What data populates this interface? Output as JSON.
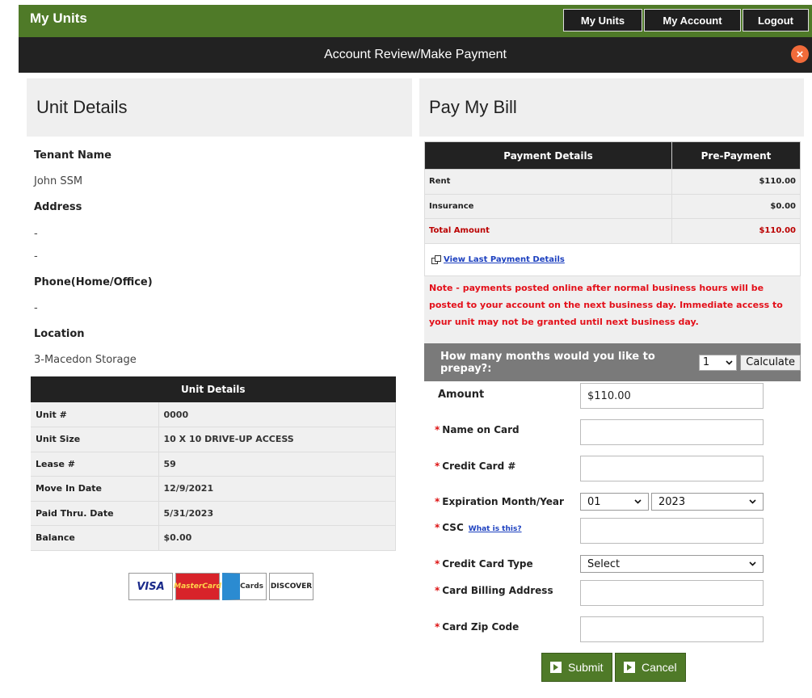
{
  "header": {
    "title": "My Units",
    "nav": [
      "My Units",
      "My Account",
      "Logout"
    ]
  },
  "modal": {
    "title": "Account Review/Make Payment",
    "close_glyph": "×"
  },
  "unit_details": {
    "section_title": "Unit Details",
    "tenant_name_label": "Tenant Name",
    "tenant_name": "John SSM",
    "address_label": "Address",
    "address_line1": "-",
    "address_line2": "-",
    "phone_label": "Phone(Home/Office)",
    "phone": "-",
    "location_label": "Location",
    "location": "3-Macedon Storage",
    "table_header": "Unit Details",
    "rows": [
      {
        "label": "Unit #",
        "value": "0000"
      },
      {
        "label": "Unit Size",
        "value": "10 X 10 DRIVE-UP ACCESS"
      },
      {
        "label": "Lease #",
        "value": "59"
      },
      {
        "label": "Move In Date",
        "value": "12/9/2021"
      },
      {
        "label": "Paid Thru. Date",
        "value": "5/31/2023"
      },
      {
        "label": "Balance",
        "value": "$0.00"
      }
    ],
    "cards": [
      "VISA",
      "MasterCard",
      "Cards",
      "DISCOVER"
    ]
  },
  "pay_bill": {
    "section_title": "Pay My Bill",
    "col_details": "Payment Details",
    "col_prepay": "Pre-Payment",
    "rows": [
      {
        "label": "Rent",
        "value": "$110.00"
      },
      {
        "label": "Insurance",
        "value": "$0.00"
      },
      {
        "label": "Total Amount",
        "value": "$110.00"
      }
    ],
    "view_last": "View Last Payment Details",
    "note": "Note - payments posted online after normal business hours will be posted to your account on the next business day. Immediate access to your unit may not be granted until next business day.",
    "prepay_question": "How many months would you like to prepay?:",
    "prepay_months": "1",
    "calculate_label": "Calculate"
  },
  "form": {
    "amount_label": "Amount",
    "amount_value": "$110.00",
    "name_label": "Name on  Card",
    "card_number_label": "Credit Card #",
    "expiration_label": "Expiration Month/Year",
    "exp_month": "01",
    "exp_year": "2023",
    "csc_label": "CSC",
    "csc_help": "What is this?",
    "card_type_label": "Credit Card Type",
    "card_type_value": "Select",
    "billing_address_label": "Card Billing Address",
    "zip_label": "Card Zip Code",
    "required_mark": "*"
  },
  "actions": {
    "submit": "Submit",
    "cancel": "Cancel"
  }
}
